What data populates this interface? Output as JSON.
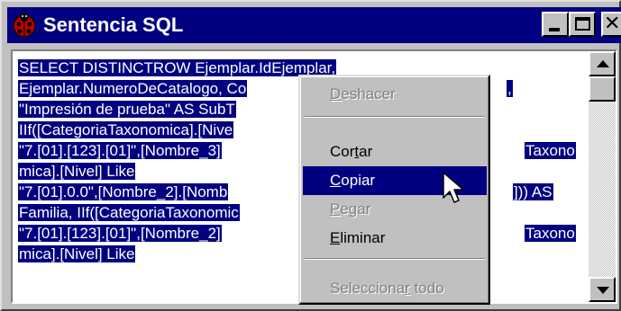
{
  "window": {
    "title": "Sentencia SQL",
    "close_glyph": "✕"
  },
  "editor": {
    "lines": [
      {
        "visible": "SELECT DISTINCTROW Ejemplar.IdEjemplar,",
        "hidden": ""
      },
      {
        "visible": "Ejemplar.NumeroDeCatalogo, Co",
        "hidden": "",
        "after": ","
      },
      {
        "visible": "\"Impresión de prueba\" AS SubT",
        "hidden": ""
      },
      {
        "visible": "IIf([CategoriaTaxonomica].[Nive",
        "hidden": ""
      },
      {
        "visible": "\"7.[01].[123].[01]\",[Nombre_3]",
        "hidden": "",
        "after": "Taxono"
      },
      {
        "visible": "mica].[Nivel] Like",
        "hidden": ""
      },
      {
        "visible": "\"7.[01].0.0\",[Nombre_2].[Nomb",
        "hidden": "",
        "after": "])) AS"
      },
      {
        "visible": "Familia, IIf([CategoriaTaxonomic",
        "hidden": ""
      },
      {
        "visible": "\"7.[01].[123].[01]\",[Nombre_2]",
        "hidden": "",
        "after": "Taxono"
      },
      {
        "visible": "mica].[Nivel] Like",
        "hidden": ""
      }
    ]
  },
  "context_menu": {
    "items": [
      {
        "pre": "",
        "u": "D",
        "post": "eshacer",
        "enabled": false
      },
      {
        "separator": true
      },
      {
        "pre": "Cor",
        "u": "t",
        "post": "ar",
        "enabled": true
      },
      {
        "pre": "",
        "u": "C",
        "post": "opiar",
        "enabled": true,
        "selected": true
      },
      {
        "pre": "",
        "u": "P",
        "post": "egar",
        "enabled": false
      },
      {
        "pre": "",
        "u": "E",
        "post": "liminar",
        "enabled": true
      },
      {
        "separator": true
      },
      {
        "pre": "Selecciona",
        "u": "r",
        "post": " todo",
        "enabled": false
      }
    ]
  },
  "colors": {
    "selection": "#000080",
    "face": "#c0c0c0"
  },
  "icons": {
    "app": "ladybug-icon",
    "cursor": "arrow-cursor-icon"
  }
}
